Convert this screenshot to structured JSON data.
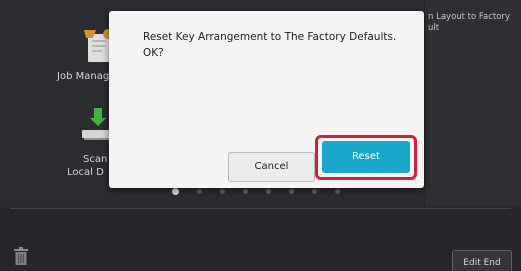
{
  "home": {
    "tiles": [
      {
        "label": "Job Manag",
        "icon": "job-manager-icon"
      },
      {
        "label_line1": "Scan",
        "label_line2": "Local D",
        "icon": "scan-to-local-drive-icon"
      }
    ],
    "side_panel": {
      "line1": "n Layout to Factory",
      "line2": "ult"
    },
    "page_indicator": {
      "total": 8,
      "active": 1
    }
  },
  "bottom_bar": {
    "trash_icon": "trash-icon",
    "edit_end_label": "Edit End"
  },
  "dialog": {
    "message_line1": "Reset Key Arrangement to The Factory Defaults.",
    "message_line2": "OK?",
    "cancel_label": "Cancel",
    "reset_label": "Reset"
  },
  "colors": {
    "accent": "#1aa6c9",
    "highlight": "#d51d3e",
    "background": "#303135"
  }
}
